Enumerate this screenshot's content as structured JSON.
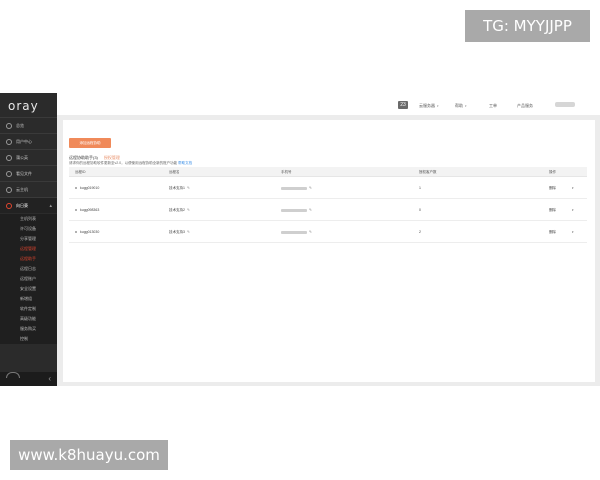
{
  "app": {
    "logo": "oray"
  },
  "sidebar": {
    "items": [
      {
        "label": "总览",
        "active": false
      },
      {
        "label": "用户中心",
        "active": false
      },
      {
        "label": "蒲公英",
        "active": false
      },
      {
        "label": "看见文件",
        "active": false
      },
      {
        "label": "云主机",
        "active": false
      },
      {
        "label": "向日葵",
        "active": true
      }
    ],
    "subitems": [
      {
        "label": "主机列表",
        "highlight": false
      },
      {
        "label": "许可设备",
        "highlight": false
      },
      {
        "label": "分享管理",
        "highlight": false
      },
      {
        "label": "远程管理",
        "highlight": true
      },
      {
        "label": "远程助手",
        "highlight": true
      },
      {
        "label": "远程日志",
        "highlight": false
      },
      {
        "label": "远程账户",
        "highlight": false
      },
      {
        "label": "安全设置",
        "highlight": false
      },
      {
        "label": "新增组",
        "highlight": false
      },
      {
        "label": "软件定制",
        "highlight": false
      },
      {
        "label": "高级功能",
        "highlight": false
      },
      {
        "label": "服务购买",
        "highlight": false
      },
      {
        "label": "控制",
        "highlight": false
      }
    ]
  },
  "topbar": {
    "badge": "23",
    "menu_1": "云服务器",
    "menu_2": "帮助",
    "menu_3": "工单",
    "menu_4": "产品服务"
  },
  "main": {
    "add_button": "添加远程协助",
    "tab_active": "远程协助助手(3)",
    "tab_inactive": "授权管理",
    "notice_text": "请求你的远程协助软件更新至v2.0，以便使用远程协助全新的账户功能",
    "notice_link": "帮助文档",
    "columns": [
      "远程ID",
      "远程名",
      "手机号",
      "授权客户数",
      "操作"
    ],
    "rows": [
      {
        "id": "kugg019010",
        "name": "技术支持1",
        "count": "1",
        "action": "删除"
      },
      {
        "id": "kugg098363",
        "name": "技术支持2",
        "count": "0",
        "action": "删除"
      },
      {
        "id": "kugg013030",
        "name": "技术支持3",
        "count": "2",
        "action": "删除"
      }
    ]
  },
  "watermarks": {
    "tg": "TG: MYYJJPP",
    "site": "www.k8huayu.com"
  },
  "colors": {
    "accent": "#f08a5a",
    "sidebar_bg": "#2b2b2b",
    "active_red": "#e2462f",
    "link_blue": "#3a8ee6"
  }
}
